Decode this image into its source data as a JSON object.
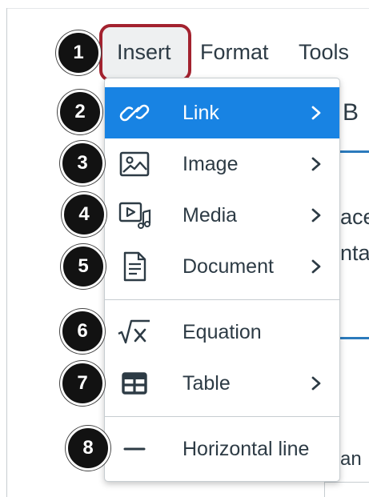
{
  "menubar": {
    "items": [
      {
        "label": "Insert"
      },
      {
        "label": "Format"
      },
      {
        "label": "Tools"
      }
    ]
  },
  "background": {
    "fragments": [
      "B",
      "ace",
      "nta",
      "an"
    ]
  },
  "dropdown": {
    "items": [
      {
        "label": "Link",
        "icon": "link-icon",
        "submenu": true,
        "active": true,
        "badge": "2"
      },
      {
        "label": "Image",
        "icon": "image-icon",
        "submenu": true,
        "badge": "3"
      },
      {
        "label": "Media",
        "icon": "media-icon",
        "submenu": true,
        "badge": "4"
      },
      {
        "label": "Document",
        "icon": "document-icon",
        "submenu": true,
        "badge": "5"
      },
      {
        "label": "Equation",
        "icon": "equation-icon",
        "submenu": false,
        "badge": "6"
      },
      {
        "label": "Table",
        "icon": "table-icon",
        "submenu": true,
        "badge": "7"
      },
      {
        "label": "Horizontal line",
        "icon": "horizontal-line-icon",
        "submenu": false,
        "badge": "8"
      }
    ]
  },
  "badges": {
    "insert": "1"
  },
  "colors": {
    "highlight_border": "#a3222f",
    "active_item": "#1883e3",
    "accent_line": "#2b7abc",
    "badge": "#121212"
  }
}
